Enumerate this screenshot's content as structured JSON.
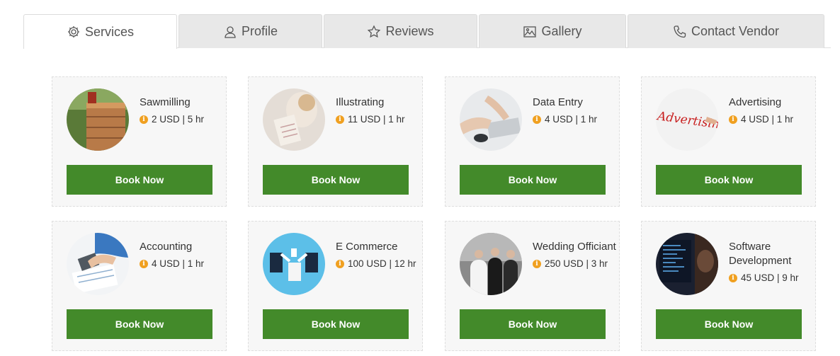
{
  "tabs": [
    {
      "label": "Services",
      "icon": "gear-icon",
      "active": true
    },
    {
      "label": "Profile",
      "icon": "user-icon",
      "active": false
    },
    {
      "label": "Reviews",
      "icon": "star-icon",
      "active": false
    },
    {
      "label": "Gallery",
      "icon": "image-icon",
      "active": false
    },
    {
      "label": "Contact Vendor",
      "icon": "phone-icon",
      "active": false
    }
  ],
  "services": [
    {
      "title": "Sawmilling",
      "price": "2 USD | 5 hr",
      "button": "Book Now"
    },
    {
      "title": "Illustrating",
      "price": "11 USD | 1 hr",
      "button": "Book Now"
    },
    {
      "title": "Data Entry",
      "price": "4 USD | 1 hr",
      "button": "Book Now"
    },
    {
      "title": "Advertising",
      "price": "4 USD | 1 hr",
      "button": "Book Now",
      "image_text": "Advertising"
    },
    {
      "title": "Accounting",
      "price": "4 USD | 1 hr",
      "button": "Book Now"
    },
    {
      "title": "E Commerce",
      "price": "100 USD | 12 hr",
      "button": "Book Now"
    },
    {
      "title": "Wedding Officiant",
      "price": "250 USD | 3 hr",
      "button": "Book Now"
    },
    {
      "title": "Software Development",
      "price": "45 USD | 9 hr",
      "button": "Book Now"
    }
  ],
  "colors": {
    "button": "#438a2a",
    "info_icon": "#f0a020"
  }
}
